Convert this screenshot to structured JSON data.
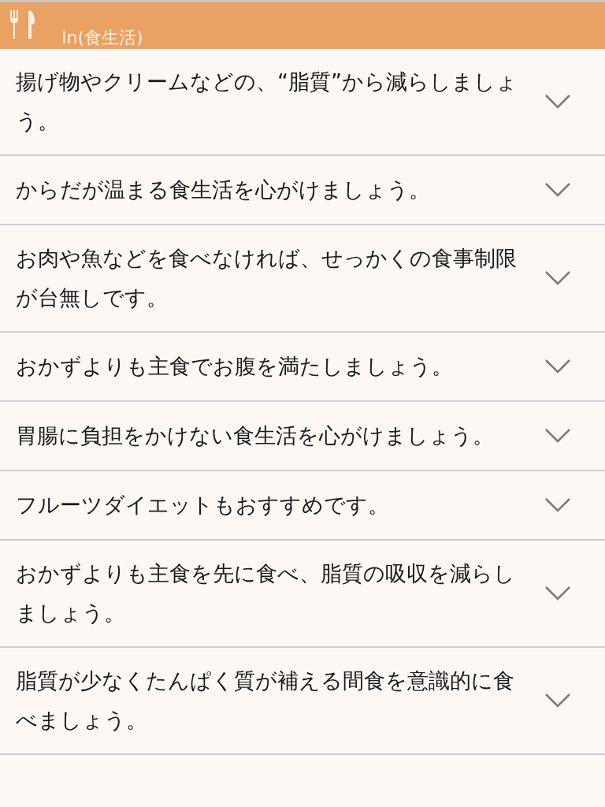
{
  "header": {
    "title": "In(食生活)"
  },
  "items": [
    {
      "text": "揚げ物やクリームなどの、“脂質”から減らしましょう。",
      "expanded": false
    },
    {
      "text": "からだが温まる食生活を心がけましょう。",
      "expanded": false
    },
    {
      "text": "お肉や魚などを食べなければ、せっかくの食事制限が台無しです。",
      "expanded": false
    },
    {
      "text": "おかずよりも主食でお腹を満たしましょう。",
      "expanded": false
    },
    {
      "text": "胃腸に負担をかけない食生活を心がけましょう。",
      "expanded": false
    },
    {
      "text": "フルーツダイエットもおすすめです。",
      "expanded": false
    },
    {
      "text": "おかずよりも主食を先に食べ、脂質の吸収を減らしましょう。",
      "expanded": false
    },
    {
      "text": "脂質が少なくたんぱく質が補える間食を意識的に食べましょう。",
      "expanded": false
    }
  ]
}
